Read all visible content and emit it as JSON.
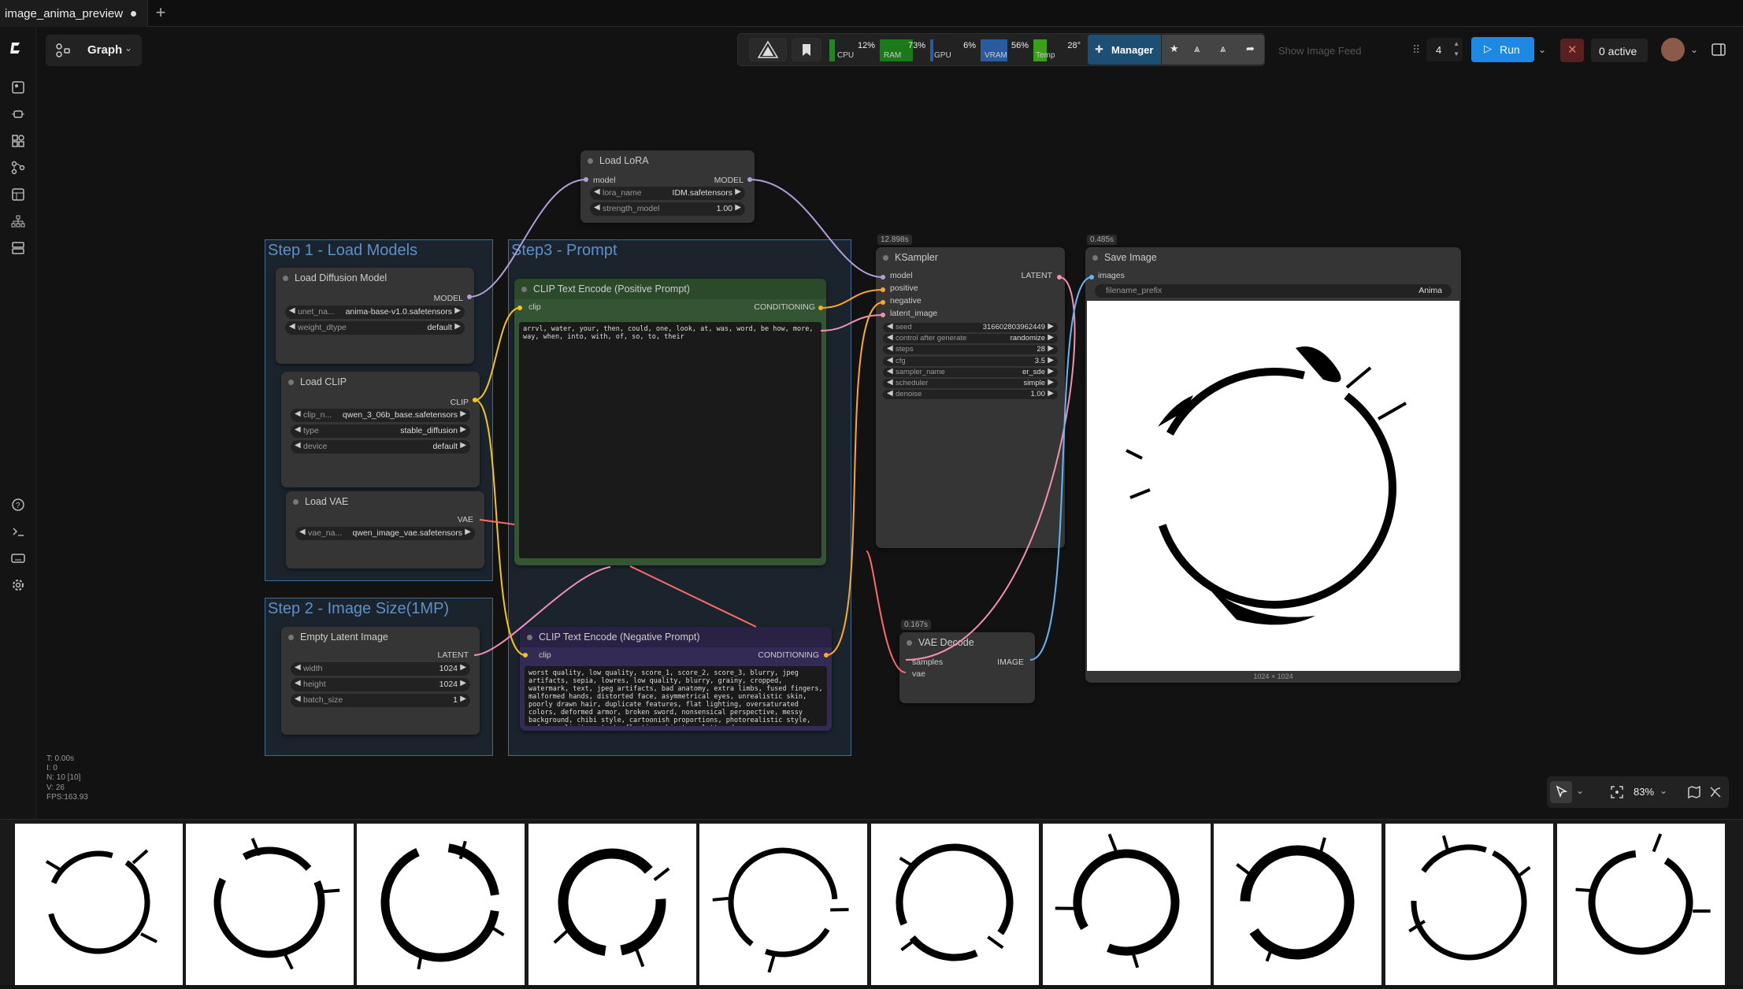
{
  "tab": {
    "title": "image_anima_preview"
  },
  "graph_button": {
    "label": "Graph"
  },
  "monitor": {
    "cpu": {
      "label": "CPU",
      "value": "12%"
    },
    "ram": {
      "label": "RAM",
      "value": "73%"
    },
    "gpu": {
      "label": "GPU",
      "value": "6%"
    },
    "vram": {
      "label": "VRAM",
      "value": "56%"
    },
    "temp": {
      "label": "Temp",
      "value": "28°"
    }
  },
  "manager_label": "Manager",
  "show_feed": "Show Image Feed",
  "queue_count": "4",
  "run_label": "Run",
  "active_label": "0 active",
  "groups": {
    "g1": "Step 1 - Load Models",
    "g2": "Step 2 - Image Size(1MP)",
    "g3": "Step3 - Prompt"
  },
  "nodes": {
    "lora": {
      "title": "Load LoRA",
      "in": "model",
      "out": "MODEL",
      "w1l": "lora_name",
      "w1v": "IDM.safetensors",
      "w2l": "strength_model",
      "w2v": "1.00"
    },
    "diffusion": {
      "title": "Load Diffusion Model",
      "out": "MODEL",
      "w1l": "unet_na...",
      "w1v": "anima-base-v1.0.safetensors",
      "w2l": "weight_dtype",
      "w2v": "default"
    },
    "clip": {
      "title": "Load CLIP",
      "out": "CLIP",
      "w1l": "clip_n...",
      "w1v": "qwen_3_06b_base.safetensors",
      "w2l": "type",
      "w2v": "stable_diffusion",
      "w3l": "device",
      "w3v": "default"
    },
    "vae": {
      "title": "Load VAE",
      "out": "VAE",
      "w1l": "vae_na...",
      "w1v": "qwen_image_vae.safetensors"
    },
    "latent": {
      "title": "Empty Latent Image",
      "out": "LATENT",
      "w1l": "width",
      "w1v": "1024",
      "w2l": "height",
      "w2v": "1024",
      "w3l": "batch_size",
      "w3v": "1"
    },
    "pos": {
      "title": "CLIP Text Encode (Positive Prompt)",
      "in": "clip",
      "out": "CONDITIONING",
      "text": "arrvl, water, your, then, could, one, look, at, was, word, be how, more, way, when, into, with, of, so, to, their"
    },
    "neg": {
      "title": "CLIP Text Encode (Negative Prompt)",
      "in": "clip",
      "out": "CONDITIONING",
      "text": "worst quality, low quality, score_1, score_2, score_3, blurry, jpeg artifacts, sepia, lowres, low quality, blurry, grainy, cropped, watermark, text, jpeg artifacts, bad anatomy, extra limbs, fused fingers, malformed hands, distorted face, asymmetrical eyes, unrealistic skin, poorly drawn hair, duplicate features, flat lighting, oversaturated colors, deformed armor, broken sword, nonsensical perspective, messy background, chibi style, cartoonish proportions, photorealistic style, nsfw, explicit content, floating objects, cluttered"
    },
    "ksampler": {
      "title": "KSampler",
      "time": "12.898s",
      "in1": "model",
      "in2": "positive",
      "in3": "negative",
      "in4": "latent_image",
      "out": "LATENT",
      "widgets": [
        {
          "l": "seed",
          "v": "316602803962449"
        },
        {
          "l": "control after generate",
          "v": "randomize"
        },
        {
          "l": "steps",
          "v": "28"
        },
        {
          "l": "cfg",
          "v": "3.5"
        },
        {
          "l": "sampler_name",
          "v": "er_sde"
        },
        {
          "l": "scheduler",
          "v": "simple"
        },
        {
          "l": "denoise",
          "v": "1.00"
        }
      ]
    },
    "save": {
      "title": "Save Image",
      "time": "0.485s",
      "in": "images",
      "w1l": "filename_prefix",
      "w1v": "Anima",
      "size": "1024 × 1024"
    },
    "vaedecode": {
      "title": "VAE Decode",
      "time": "0.167s",
      "in1": "samples",
      "in2": "vae",
      "out": "IMAGE"
    }
  },
  "stats": {
    "t": "T: 0.00s",
    "i": "I: 0",
    "n": "N: 10 [10]",
    "v": "V: 26",
    "fps": "FPS:163.93"
  },
  "zoom": "83%"
}
